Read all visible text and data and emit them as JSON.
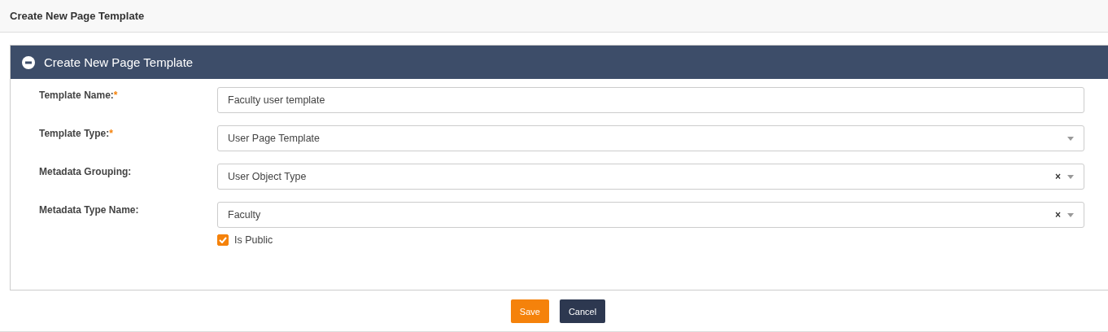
{
  "page_title": "Create New Page Template",
  "panel": {
    "title": "Create New Page Template",
    "expanded": true,
    "fields": [
      {
        "kind": "text",
        "label": "Template Name:",
        "required_mark": "*",
        "value": "Faculty user template"
      },
      {
        "kind": "select",
        "label": "Template Type:",
        "required_mark": "*",
        "value": "User Page Template"
      },
      {
        "kind": "select",
        "label": "Metadata Grouping:",
        "value": "User Object Type",
        "clear_symbol": "×"
      },
      {
        "kind": "select",
        "label": "Metadata Type Name:",
        "value": "Faculty",
        "clear_symbol": "×"
      }
    ],
    "checkbox": {
      "label": "Is Public",
      "checked": true
    }
  },
  "buttons": [
    {
      "kind": "primary",
      "label": "Save"
    },
    {
      "kind": "secondary",
      "label": "Cancel"
    }
  ]
}
